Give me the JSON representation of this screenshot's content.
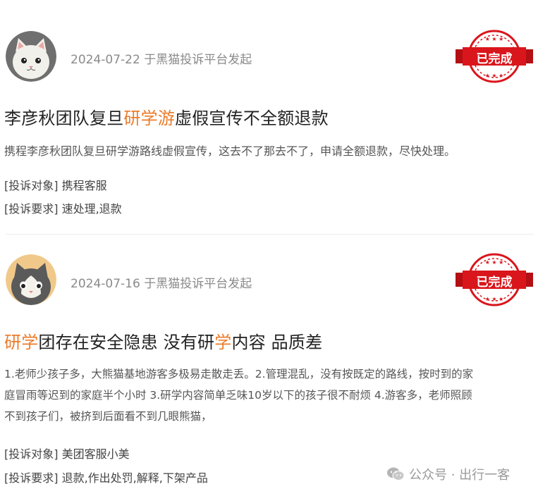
{
  "complaints": [
    {
      "date": "2024-07-22",
      "source": "于黑猫投诉平台发起",
      "status": "已完成",
      "title_parts": [
        "李彦秋团队复旦",
        "研学游",
        "虚假宣传不全额退款"
      ],
      "description": "携程李彦秋团队复旦研学游路线虚假宣传，这去不了那去不了，申请全额退款，尽快处理。",
      "target_label": "[投诉对象]",
      "target_value": "携程客服",
      "request_label": "[投诉要求]",
      "request_value": "速处理,退款"
    },
    {
      "date": "2024-07-16",
      "source": "于黑猫投诉平台发起",
      "status": "已完成",
      "title_parts": [
        "研学",
        "团存在安全隐患 没有研",
        "学",
        "内容 品质差"
      ],
      "description_lines": [
        "1.老师少孩子多，大熊猫基地游客多极易走散走丢。2.管理混乱，没有按既定的路线，按时到的家",
        "庭冒雨等迟到的家庭半个小时 3.研学内容简单乏味10岁以下的孩子很不耐烦 4.游客多，老师照顾",
        "不到孩子们，被挤到后面看不到几眼熊猫，"
      ],
      "target_label": "[投诉对象]",
      "target_value": "美团客服小美",
      "request_label": "[投诉要求]",
      "request_value": "退款,作出处罚,解释,下架产品"
    }
  ],
  "watermark": {
    "text": "公众号 · 出行一客",
    "icon": "wechat-icon"
  },
  "colors": {
    "highlight": "#ec7b2a",
    "stamp_red": "#d9161c",
    "meta_gray": "#8a8a8a"
  }
}
